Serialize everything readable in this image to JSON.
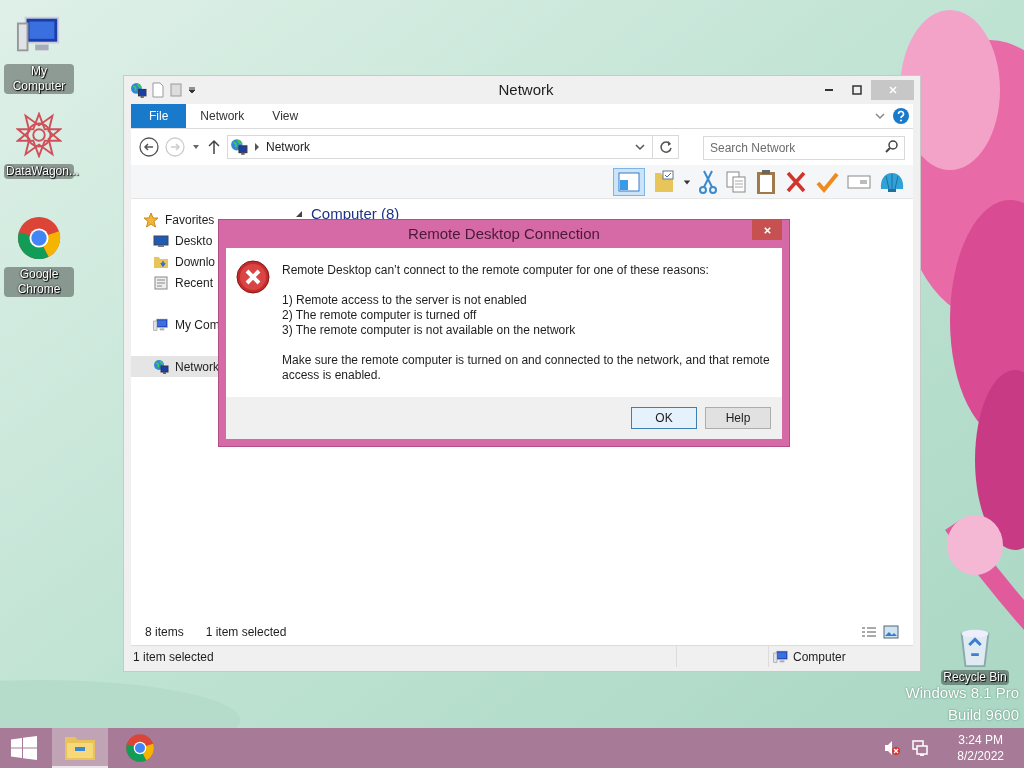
{
  "desktop_icons": [
    {
      "kind": "computer",
      "label": "My Computer"
    },
    {
      "kind": "star",
      "label": "DataWagon..."
    },
    {
      "kind": "chrome",
      "label": "Google Chrome"
    }
  ],
  "recycle_bin": {
    "label": "Recycle Bin"
  },
  "watermark": [
    "Windows 8.1 Pro",
    "Build 9600"
  ],
  "explorer": {
    "title": "Network",
    "ribbon_tabs": [
      {
        "label": "File",
        "selected": true
      },
      {
        "label": "Network",
        "selected": false
      },
      {
        "label": "View",
        "selected": false
      }
    ],
    "address": {
      "path": "Network"
    },
    "search": {
      "placeholder": "Search Network"
    },
    "nav_items": [
      {
        "kind": "star",
        "label": "Favorites",
        "selected": false
      },
      {
        "kind": "desktop",
        "label": "Deskto",
        "selected": false
      },
      {
        "kind": "download",
        "label": "Downlo",
        "selected": false
      },
      {
        "kind": "recent",
        "label": "Recent",
        "selected": false
      },
      {
        "kind": "computer",
        "label": "My Com",
        "selected": false
      },
      {
        "kind": "network",
        "label": "Network",
        "selected": true
      }
    ],
    "group_heading": "Computer (8)",
    "item_count": "8 items",
    "selection_count": "1 item selected",
    "status_bar": {
      "left": "1 item selected",
      "right": "Computer"
    }
  },
  "dialog": {
    "title": "Remote Desktop Connection",
    "message": "Remote Desktop can’t connect to the remote computer for one of these reasons:",
    "reasons": [
      "1) Remote access to the server is not enabled",
      "2) The remote computer is turned off",
      "3) The remote computer is not available on the network"
    ],
    "note": "Make sure the remote computer is turned on and connected to the network, and that remote access is enabled.",
    "buttons": [
      {
        "label": "OK",
        "default": true
      },
      {
        "label": "Help",
        "default": false
      }
    ]
  },
  "taskbar": {
    "apps": [
      {
        "kind": "explorer",
        "selected": true
      },
      {
        "kind": "chrome",
        "selected": false
      }
    ],
    "tray": {
      "muted": true
    },
    "time": "3:24 PM",
    "date": "8/2/2022"
  }
}
